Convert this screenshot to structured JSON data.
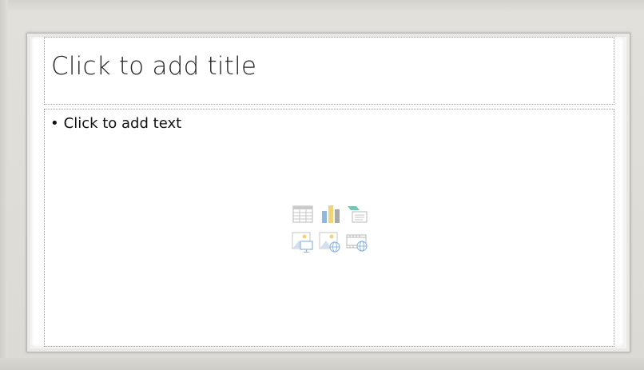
{
  "slide": {
    "title_placeholder": "Click to add title",
    "content_placeholder": {
      "bullet": "•",
      "text": "Click to add text"
    }
  },
  "insert_icons": [
    {
      "name": "insert-table-icon"
    },
    {
      "name": "insert-chart-icon"
    },
    {
      "name": "insert-smartart-icon"
    },
    {
      "name": "insert-picture-icon"
    },
    {
      "name": "insert-online-picture-icon"
    },
    {
      "name": "insert-video-icon"
    }
  ],
  "colors": {
    "workspace_bg": "#dedcd6",
    "slide_bg": "#ffffff",
    "title_text": "#262626",
    "body_text": "#111111",
    "placeholder_border": "#9a9a9a",
    "icon_gray": "#b8b8b8",
    "icon_blue": "#8fb7e0",
    "icon_yellow": "#f2d27a",
    "icon_teal": "#78c4b4"
  }
}
